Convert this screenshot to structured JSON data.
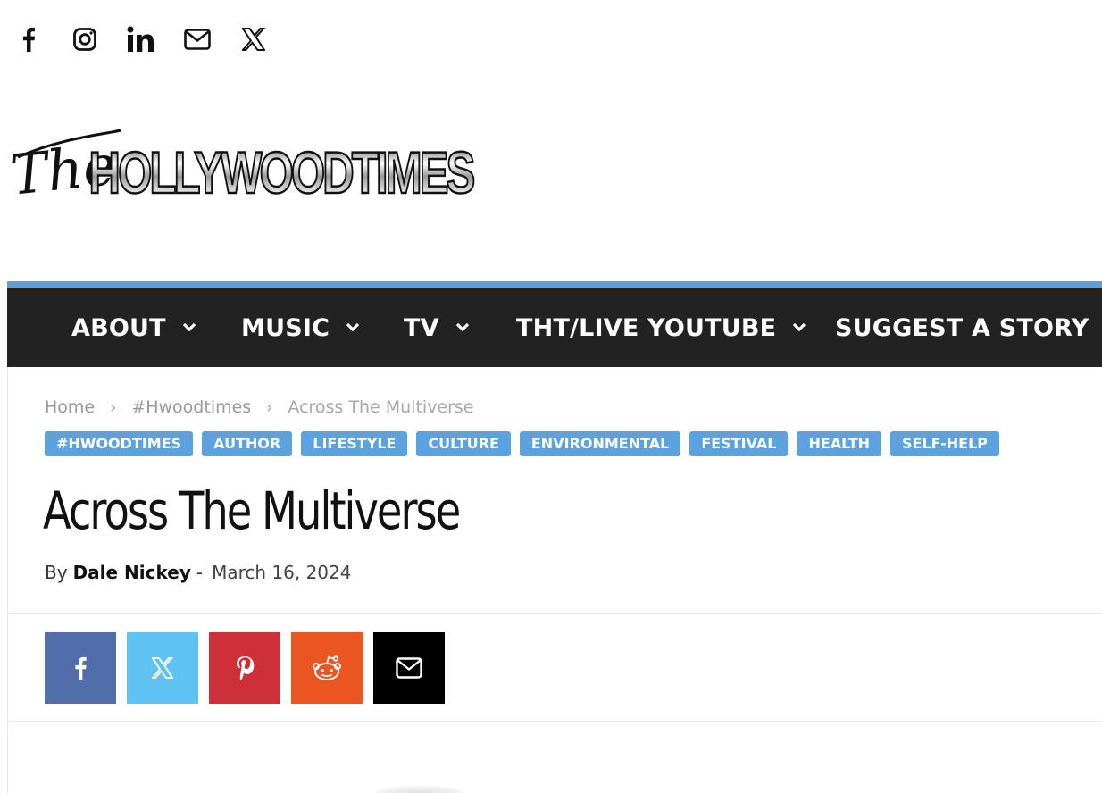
{
  "top_social": [
    {
      "name": "facebook-icon"
    },
    {
      "name": "instagram-icon"
    },
    {
      "name": "linkedin-icon"
    },
    {
      "name": "mail-icon"
    },
    {
      "name": "x-twitter-icon"
    }
  ],
  "logo": {
    "script_text": "The",
    "main_text": "HOLLYWOODTIMES"
  },
  "nav": {
    "items": [
      {
        "label": "ABOUT"
      },
      {
        "label": "MUSIC"
      },
      {
        "label": "TV"
      },
      {
        "label": "THT/LIVE YOUTUBE"
      },
      {
        "label": "SUGGEST A STORY"
      }
    ]
  },
  "breadcrumb": {
    "items": [
      "Home",
      "#Hwoodtimes",
      "Across The Multiverse"
    ],
    "separator": "›"
  },
  "tags": [
    "#HWOODTIMES",
    "AUTHOR",
    "LIFESTYLE",
    "CULTURE",
    "ENVIRONMENTAL",
    "FESTIVAL",
    "HEALTH",
    "SELF-HELP"
  ],
  "article": {
    "title": "Across The Multiverse",
    "by_prefix": "By",
    "author": "Dale Nickey",
    "dash": "-",
    "date": "March 16, 2024"
  },
  "share": [
    {
      "name": "facebook",
      "color": "#516eab"
    },
    {
      "name": "x-twitter",
      "color": "#5ec3f0"
    },
    {
      "name": "pinterest",
      "color": "#ca212a"
    },
    {
      "name": "reddit",
      "color": "#ea5522"
    },
    {
      "name": "email",
      "color": "#000000"
    }
  ],
  "colors": {
    "nav_bg": "#222222",
    "nav_accent": "#5a9fe0",
    "tag_bg": "#5aa2e0"
  }
}
